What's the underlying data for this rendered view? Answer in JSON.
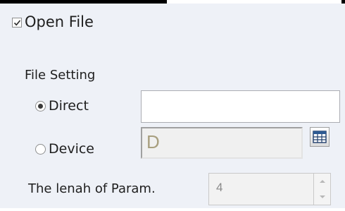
{
  "open_file": {
    "label": "Open File",
    "checked": true
  },
  "file_setting": {
    "title": "File Setting",
    "options": [
      {
        "label": "Direct",
        "selected": true
      },
      {
        "label": "Device",
        "selected": false
      }
    ],
    "direct_value": "",
    "device_value": "D",
    "device_button_icon": "grid-calendar-icon"
  },
  "param": {
    "label": "The lenah of Param.",
    "value": "4",
    "spinner_icons": [
      "spin-up-icon",
      "spin-down-icon"
    ]
  },
  "colors": {
    "panel_background": "#eef1f7",
    "text": "#1e1e1e",
    "disabled_text": "#8a8a8a",
    "device_text": "#a89f7f"
  }
}
